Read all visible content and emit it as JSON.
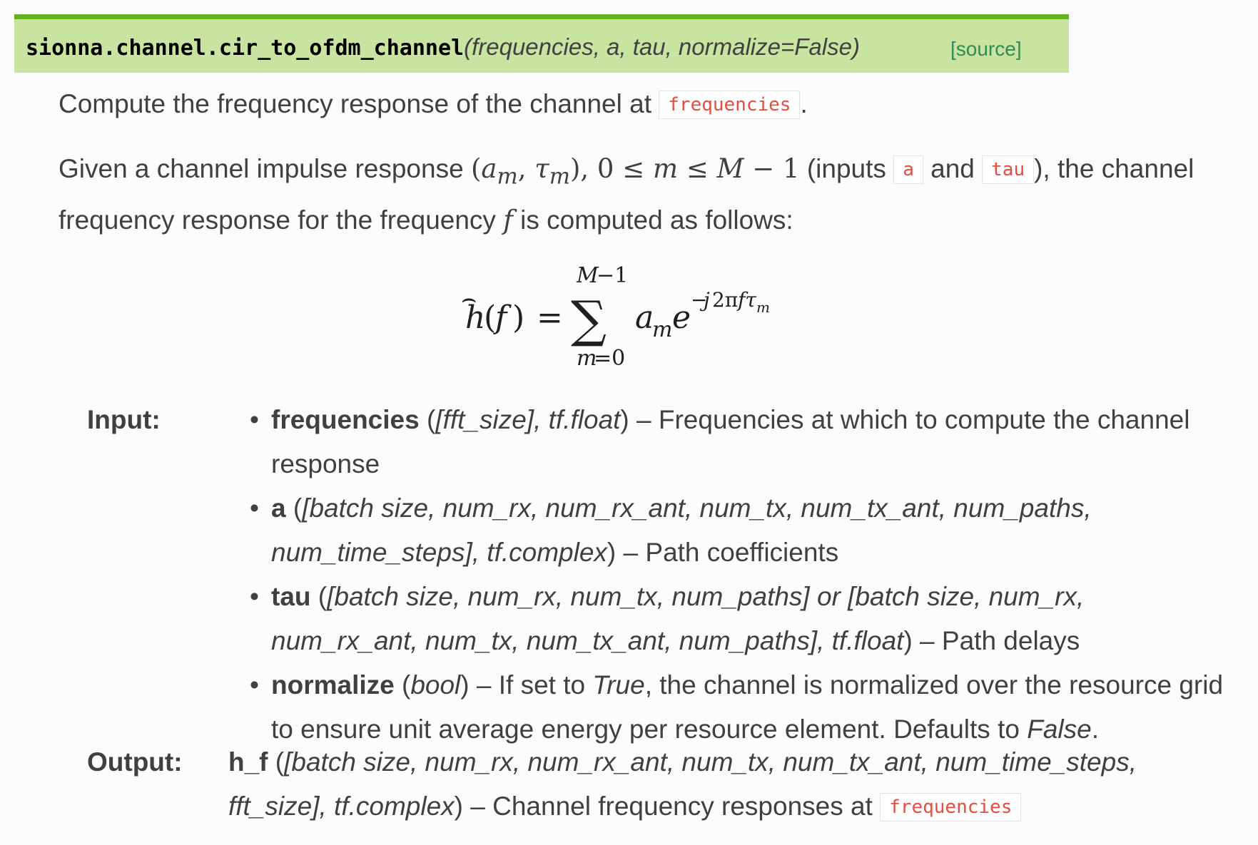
{
  "signature": {
    "function_name": "sionna.channel.cir_to_ofdm_channel",
    "params": "(frequencies, a, tau, normalize=False)",
    "source_link": "[source]"
  },
  "description": {
    "line1_text": "Compute the frequency response of the channel at ",
    "line1_code": "frequencies",
    "line1_end": ".",
    "line2_pre": "Given a channel impulse response ",
    "line2_inputs_pre": " (inputs ",
    "code_a": "a",
    "and_word": " and ",
    "code_tau": "tau",
    "line2_post": "), the channel frequency response for the frequency ",
    "line2_end": " is computed as follows:"
  },
  "input_label": "Input:",
  "inputs": [
    {
      "name": "frequencies",
      "type_pre": " (",
      "type": "[fft_size], tf.float",
      "type_post": ")",
      "desc": " – Frequencies at which to compute the channel response"
    },
    {
      "name": "a",
      "type_pre": " (",
      "type": "[batch size, num_rx, num_rx_ant, num_tx, num_tx_ant, num_paths, num_time_steps], tf.complex",
      "type_post": ")",
      "desc": " – Path coefficients"
    },
    {
      "name": "tau",
      "type_pre": " (",
      "type": "[batch size, num_rx, num_tx, num_paths] or [batch size, num_rx, num_rx_ant, num_tx, num_tx_ant, num_paths], tf.float",
      "type_post": ")",
      "desc": " – Path delays"
    },
    {
      "name": "normalize",
      "type_pre": " (",
      "type": "bool",
      "type_post": ")",
      "desc_pre": " – If set to ",
      "desc_italic": "True",
      "desc_mid": ", the channel is normalized over the resource grid to ensure unit average energy per resource element. Defaults to ",
      "desc_italic2": "False",
      "desc_end": "."
    }
  ],
  "output_label": "Output:",
  "output": {
    "name": "h_f",
    "type_pre": " (",
    "type": "[batch size, num_rx, num_rx_ant, num_tx, num_tx_ant, num_time_steps, fft_size], tf.complex",
    "type_post": ")",
    "desc": " – Channel frequency responses at ",
    "code": "frequencies"
  }
}
